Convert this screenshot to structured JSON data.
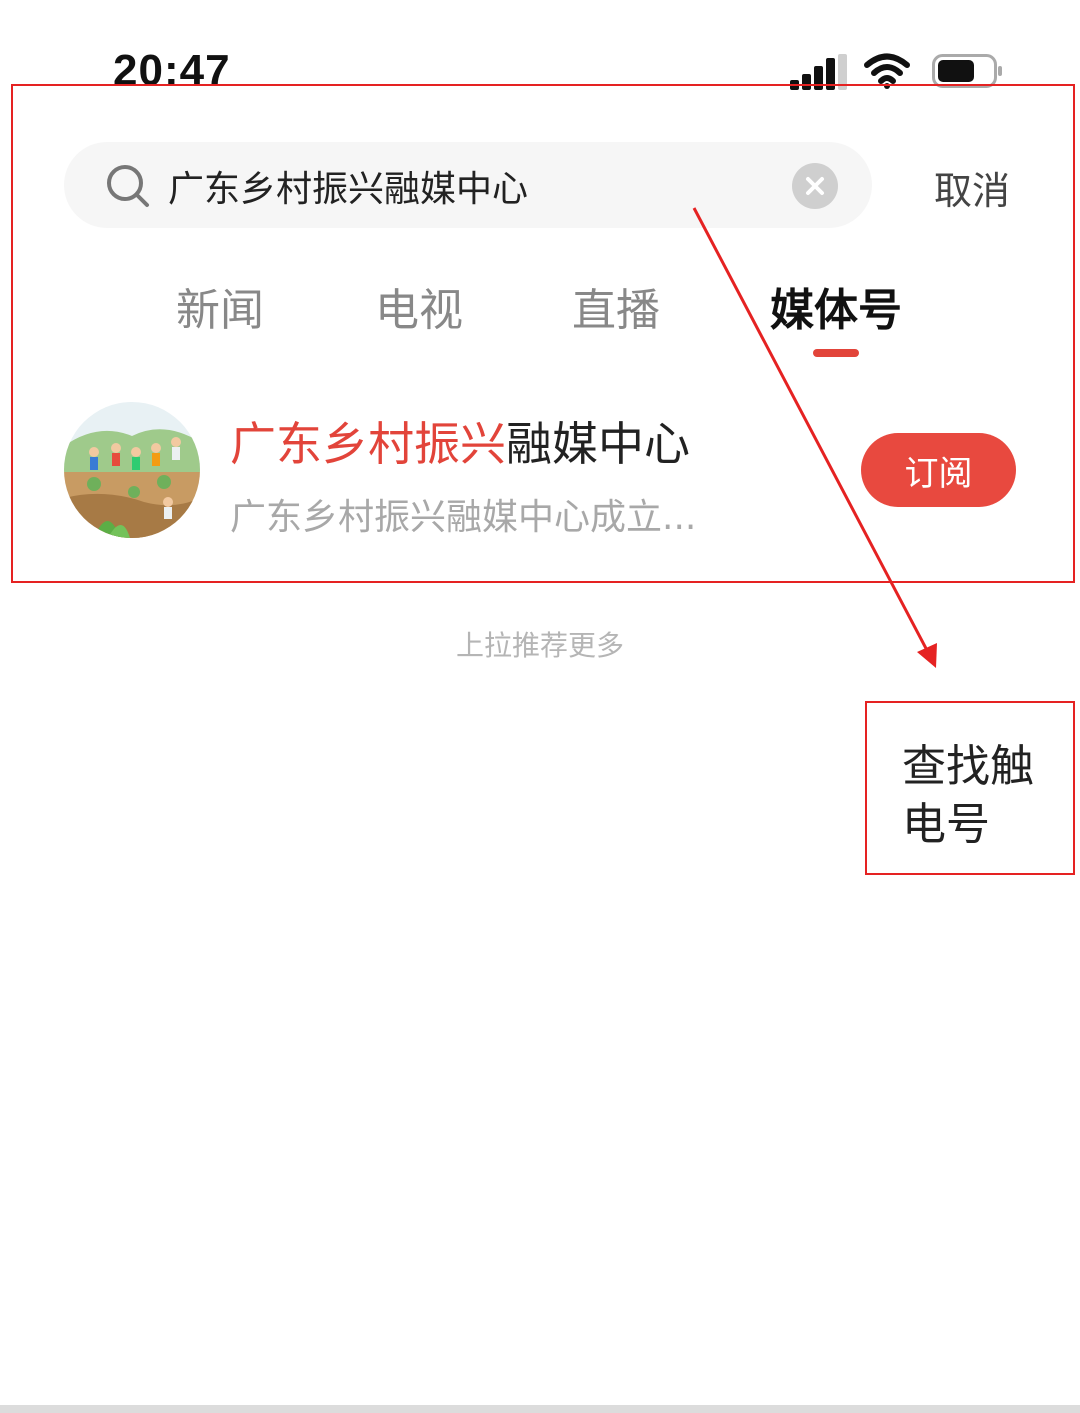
{
  "status_bar": {
    "time": "20:47",
    "icons": [
      "signal-icon",
      "wifi-icon",
      "battery-icon"
    ]
  },
  "search": {
    "value": "广东乡村振兴融媒中心",
    "cancel_label": "取消",
    "icons": [
      "search-icon",
      "clear-icon"
    ]
  },
  "tabs": [
    {
      "label": "新闻",
      "active": false
    },
    {
      "label": "电视",
      "active": false
    },
    {
      "label": "直播",
      "active": false
    },
    {
      "label": "媒体号",
      "active": true
    }
  ],
  "result": {
    "title_highlight": "广东乡村振兴",
    "title_rest": "融媒中心",
    "description": "广东乡村振兴融媒中心成立...",
    "subscribe_label": "订阅"
  },
  "pull_hint": "上拉推荐更多",
  "annotation": {
    "note": "查找触电号",
    "color": "#e52222"
  },
  "colors": {
    "accent": "#e2443a",
    "button": "#e8493f"
  }
}
